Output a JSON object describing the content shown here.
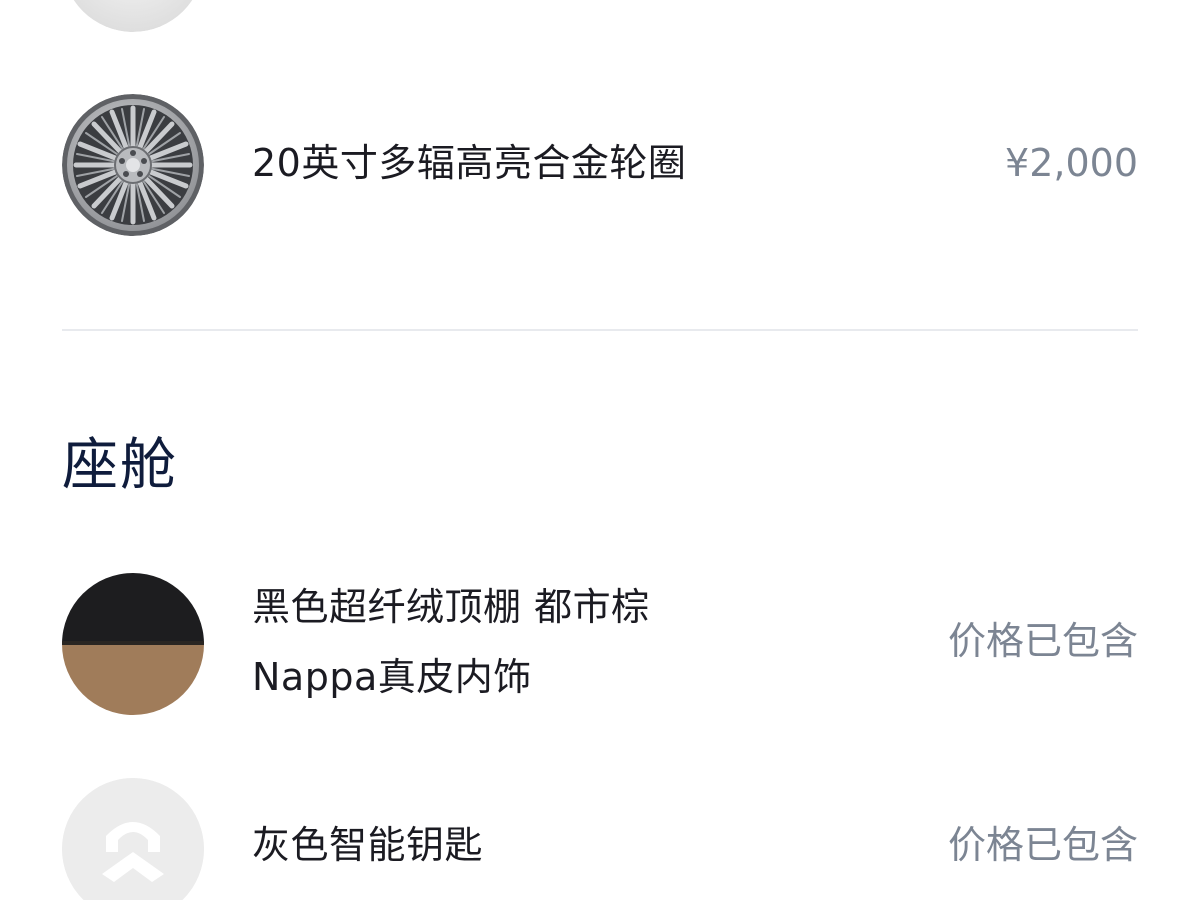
{
  "exterior": {
    "wheel": {
      "name": "20英寸多辐高亮合金轮圈",
      "price": "¥2,000",
      "icon": "alloy-wheel-thumbnail"
    }
  },
  "cabin": {
    "title": "座舱",
    "items": [
      {
        "name_line1": "黑色超纤绒顶棚 都市棕",
        "name_line2": "Nappa真皮内饰",
        "price": "价格已包含",
        "icon": "interior-swatch-thumbnail",
        "colors": {
          "top": "#1d1d1f",
          "bottom": "#a07c5a"
        }
      },
      {
        "name": "灰色智能钥匙",
        "price": "价格已包含",
        "icon": "nio-key-thumbnail"
      }
    ]
  },
  "colors": {
    "title": "#0f1c3c",
    "text": "#1b1b22",
    "muted": "#7c8593",
    "divider": "#e8eaee",
    "placeholder": "#eeeeee"
  }
}
